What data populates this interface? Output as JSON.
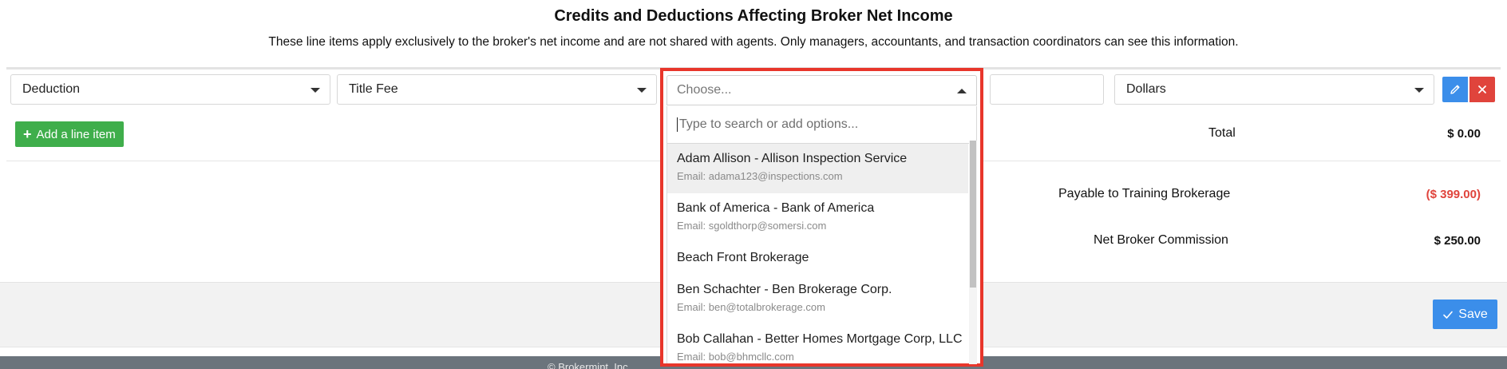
{
  "header": {
    "title": "Credits and Deductions Affecting Broker Net Income",
    "subtitle": "These line items apply exclusively to the broker's net income and are not shared with agents. Only managers, accountants, and transaction coordinators can see this information."
  },
  "line_item": {
    "type_value": "Deduction",
    "category_value": "Title Fee",
    "payee_placeholder": "Choose...",
    "amount_value": "",
    "unit_value": "Dollars"
  },
  "dropdown": {
    "search_placeholder": "Type to search or add options...",
    "options": [
      {
        "name": "Adam Allison - Allison Inspection Service",
        "email": "Email: adama123@inspections.com"
      },
      {
        "name": "Bank of America - Bank of America",
        "email": "Email: sgoldthorp@somersi.com"
      },
      {
        "name": "Beach Front Brokerage",
        "email": ""
      },
      {
        "name": "Ben Schachter - Ben Brokerage Corp.",
        "email": "Email: ben@totalbrokerage.com"
      },
      {
        "name": "Bob Callahan - Better Homes Mortgage Corp, LLC",
        "email": "Email: bob@bhmcllc.com"
      }
    ]
  },
  "actions": {
    "add_line_item": "Add a line item",
    "save": "Save"
  },
  "totals": {
    "total_label": "Total",
    "total_value": "$ 0.00",
    "payable_label": "Payable to Training Brokerage",
    "payable_value": "($ 399.00)",
    "net_label": "Net Broker Commission",
    "net_value": "$ 250.00"
  },
  "footer": {
    "text": "© Brokermint, Inc."
  },
  "colors": {
    "accent_blue": "#3b8eea",
    "add_green": "#3fae4b",
    "delete_red": "#e0443c",
    "highlight_red": "#e8362b",
    "negative_red": "#e0443c"
  },
  "icons": {
    "edit": "pencil-icon",
    "delete": "close-icon",
    "add": "plus-icon",
    "save": "check-icon"
  }
}
